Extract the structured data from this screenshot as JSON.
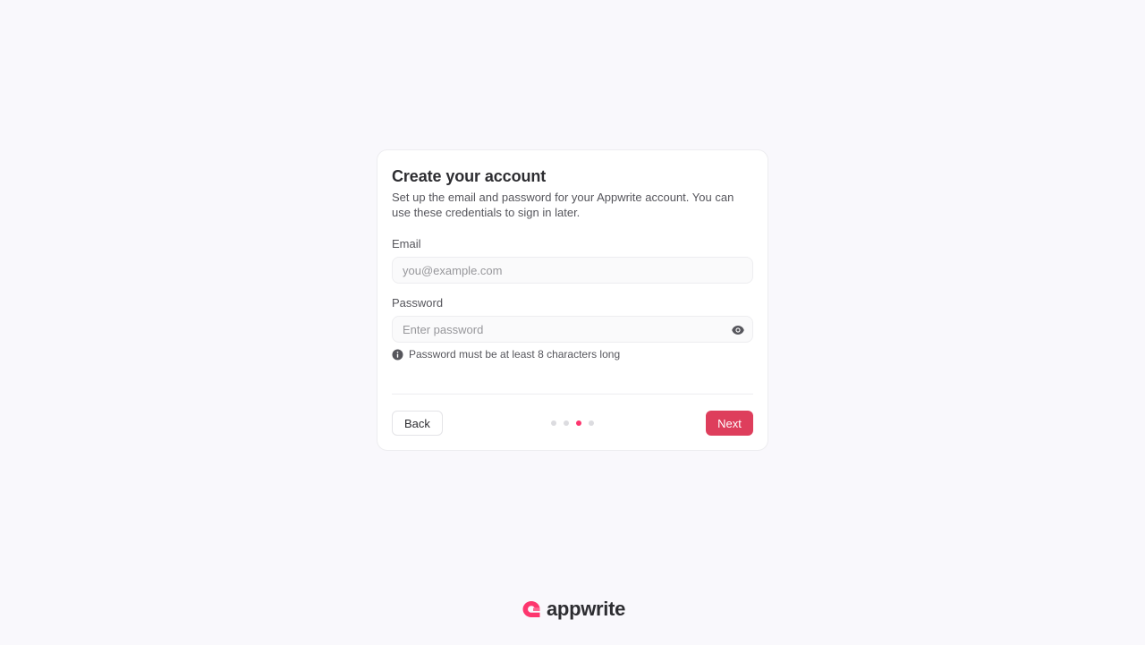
{
  "form": {
    "title": "Create your account",
    "subtitle": "Set up the email and password for your Appwrite account. You can use these credentials to sign in later.",
    "email": {
      "label": "Email",
      "value": "",
      "placeholder": "you@example.com"
    },
    "password": {
      "label": "Password",
      "value": "",
      "placeholder": "Enter password",
      "toggle_icon": "eye-icon",
      "hint": "Password must be at least 8 characters long",
      "hint_icon": "info-icon"
    }
  },
  "footer": {
    "back_label": "Back",
    "next_label": "Next",
    "steps_total": 4,
    "current_step": 3
  },
  "brand": {
    "name": "appwrite",
    "accent_color": "#fd366e",
    "button_color": "#de3e5c"
  }
}
